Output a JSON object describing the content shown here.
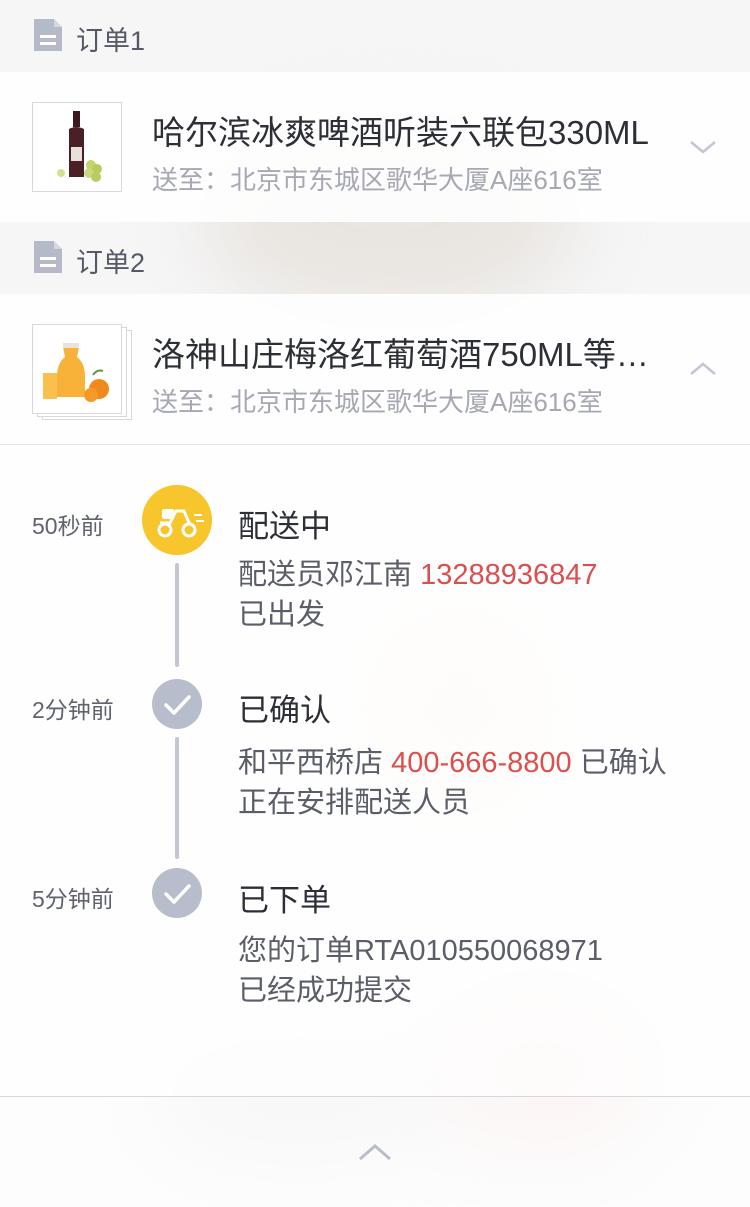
{
  "orders": [
    {
      "title": "订单1",
      "product_name": "哈尔滨冰爽啤酒听装六联包330ML",
      "address": "送至：北京市东城区歌华大厦A座616室",
      "expanded": false
    },
    {
      "title": "订单2",
      "product_name": "洛神山庄梅洛红葡萄酒750ML等 ...",
      "address": "送至：北京市东城区歌华大厦A座616室",
      "expanded": true
    }
  ],
  "timeline": {
    "events": [
      {
        "time": "50秒前",
        "status": "配送中",
        "desc_prefix": "配送员邓江南 ",
        "desc_highlight": "13288936847",
        "desc_suffix": "",
        "desc_line2": "已出发"
      },
      {
        "time": "2分钟前",
        "status": "已确认",
        "desc_prefix": "和平西桥店 ",
        "desc_highlight": "400-666-8800",
        "desc_suffix": " 已确认",
        "desc_line2": "正在安排配送人员"
      },
      {
        "time": "5分钟前",
        "status": "已下单",
        "desc_prefix": "您的订单RTA010550068971",
        "desc_highlight": "",
        "desc_suffix": "",
        "desc_line2": "已经成功提交"
      }
    ]
  },
  "colors": {
    "accent_yellow": "#f7c52c",
    "highlight_red": "#d9504e",
    "dot_gray": "#b8bdcc"
  },
  "icons": {
    "order_header": "document-icon",
    "collapsed": "chevron-down-icon",
    "expanded": "chevron-up-icon",
    "active_status": "delivery-scooter-icon",
    "done_status": "check-icon",
    "bottom": "chevron-up-icon"
  }
}
